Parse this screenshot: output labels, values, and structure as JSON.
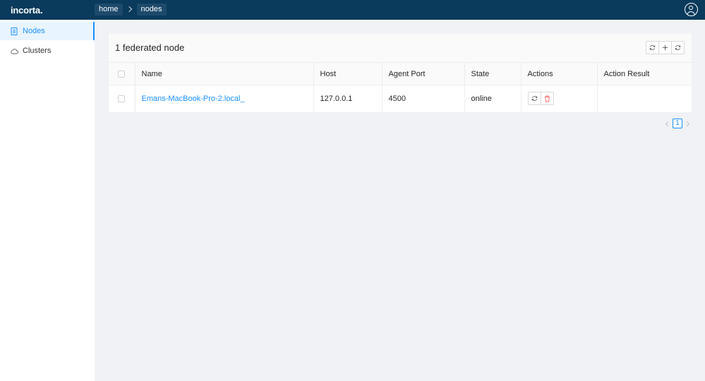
{
  "app": {
    "logo": "incorta."
  },
  "breadcrumb": [
    {
      "label": "home"
    },
    {
      "label": "nodes"
    }
  ],
  "sidebar": {
    "items": [
      {
        "label": "Nodes",
        "icon": "document-icon",
        "active": true
      },
      {
        "label": "Clusters",
        "icon": "cloud-icon",
        "active": false
      }
    ]
  },
  "panel": {
    "title": "1 federated node"
  },
  "table": {
    "columns": [
      "Name",
      "Host",
      "Agent Port",
      "State",
      "Actions",
      "Action Result"
    ],
    "rows": [
      {
        "name": "Emans-MacBook-Pro-2.local_",
        "host": "127.0.0.1",
        "agent_port": "4500",
        "state": "online",
        "action_result": ""
      }
    ]
  },
  "pagination": {
    "current_page": "1"
  },
  "colors": {
    "header_bg": "#0a3a5c",
    "accent": "#1890ff",
    "danger": "#ff4d4f"
  }
}
